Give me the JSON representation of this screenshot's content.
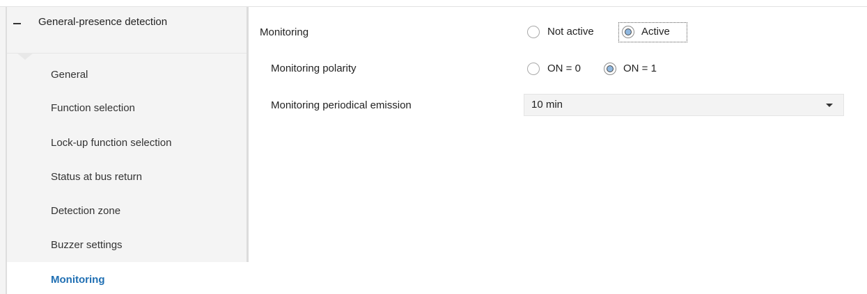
{
  "sidebar": {
    "group_label": "General-presence detection",
    "items": [
      {
        "label": "General"
      },
      {
        "label": "Function selection"
      },
      {
        "label": "Lock-up function selection"
      },
      {
        "label": "Status at bus return"
      },
      {
        "label": "Detection zone"
      },
      {
        "label": "Buzzer settings"
      },
      {
        "label": "Monitoring"
      }
    ],
    "active_item": "Monitoring"
  },
  "main": {
    "monitoring": {
      "label": "Monitoring",
      "options": [
        "Not active",
        "Active"
      ],
      "selected": "Active"
    },
    "polarity": {
      "label": "Monitoring polarity",
      "options": [
        "ON = 0",
        "ON = 1"
      ],
      "selected": "ON = 1"
    },
    "periodical_emission": {
      "label": "Monitoring periodical emission",
      "value": "10 min"
    }
  },
  "colors": {
    "active_nav": "#1f6fb3",
    "radio_fill": "#8fb7df",
    "sidebar_bg": "#f4f4f4"
  },
  "icons": {
    "collapse": "minus-icon",
    "dropdown": "triangle-down-icon"
  }
}
